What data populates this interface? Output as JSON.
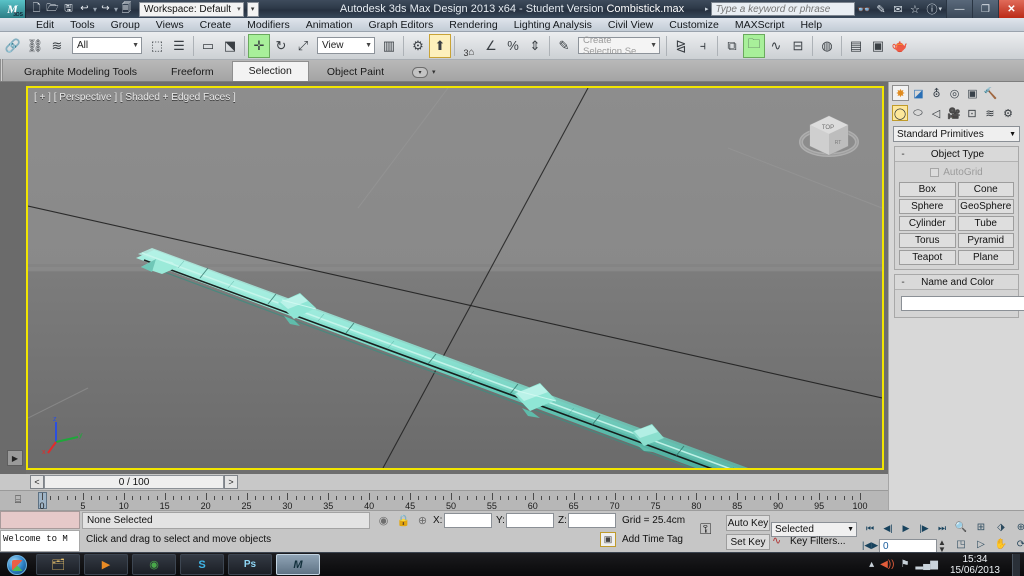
{
  "titlebar": {
    "app_icon": "3dsmax-logo-icon",
    "quick_access": [
      {
        "name": "new-file-button",
        "glyph": "🗋"
      },
      {
        "name": "open-file-button",
        "glyph": "🗁"
      },
      {
        "name": "save-file-button",
        "glyph": "🖫"
      },
      {
        "name": "undo-button",
        "glyph": "↩"
      },
      {
        "name": "redo-button",
        "glyph": "↪"
      },
      {
        "name": "project-folder-button",
        "glyph": "🗐"
      }
    ],
    "workspace_label": "Workspace: Default",
    "title": "Autodesk 3ds Max Design 2013 x64  - Student Version  ",
    "filename": "Combistick.max",
    "search_placeholder": "Type a keyword or phrase",
    "right_icons": [
      {
        "name": "search-binoculars-icon",
        "glyph": "👓"
      },
      {
        "name": "subscription-center-icon",
        "glyph": "✎"
      },
      {
        "name": "communication-center-icon",
        "glyph": "✉"
      },
      {
        "name": "favorites-star-icon",
        "glyph": "☆"
      },
      {
        "name": "help-icon",
        "glyph": "?"
      }
    ],
    "window_buttons": [
      {
        "name": "minimize-button",
        "glyph": "—"
      },
      {
        "name": "restore-button",
        "glyph": "❐"
      },
      {
        "name": "close-button",
        "glyph": "✕"
      }
    ]
  },
  "menubar": {
    "items": [
      "Edit",
      "Tools",
      "Group",
      "Views",
      "Create",
      "Modifiers",
      "Animation",
      "Graph Editors",
      "Rendering",
      "Lighting Analysis",
      "Civil View",
      "Customize",
      "MAXScript",
      "Help"
    ]
  },
  "maintoolbar": {
    "selection_filter": "All",
    "reference_coord": "View",
    "named_selection_placeholder": "Create Selection Se",
    "angle_snap_value": "3",
    "buttons": [
      {
        "name": "select-and-link-icon",
        "glyph": "🔗"
      },
      {
        "name": "unlink-selection-icon",
        "glyph": "⛓"
      },
      {
        "name": "bind-to-space-warp-icon",
        "glyph": "≈"
      },
      {
        "name": "select-object-icon",
        "glyph": "⬚"
      },
      {
        "name": "select-by-name-icon",
        "glyph": "☰"
      },
      {
        "name": "rectangular-selection-region-icon",
        "glyph": "▭"
      },
      {
        "name": "window-crossing-icon",
        "glyph": "⬓"
      },
      {
        "name": "select-and-move-icon",
        "glyph": "✛"
      },
      {
        "name": "select-and-rotate-icon",
        "glyph": "↻"
      },
      {
        "name": "select-and-scale-icon",
        "glyph": "⤢"
      },
      {
        "name": "use-center-flyout-icon",
        "glyph": "⌖"
      },
      {
        "name": "select-and-manipulate-icon",
        "glyph": "⬆"
      },
      {
        "name": "snaps-toggle-icon",
        "glyph": "🧲"
      },
      {
        "name": "angle-snap-toggle-icon",
        "glyph": "∠"
      },
      {
        "name": "percent-snap-toggle-icon",
        "glyph": "%"
      },
      {
        "name": "spinner-snap-toggle-icon",
        "glyph": "⇕"
      },
      {
        "name": "edit-named-selection-icon",
        "glyph": "✎"
      },
      {
        "name": "mirror-icon",
        "glyph": "⧎"
      },
      {
        "name": "align-icon",
        "glyph": "⌷"
      },
      {
        "name": "layer-manager-icon",
        "glyph": "⧉"
      },
      {
        "name": "curve-editor-icon",
        "glyph": "∿"
      },
      {
        "name": "schematic-view-icon",
        "glyph": "⊟"
      },
      {
        "name": "material-editor-icon",
        "glyph": "◎"
      },
      {
        "name": "render-setup-icon",
        "glyph": "⚙"
      },
      {
        "name": "rendered-frame-window-icon",
        "glyph": "▣"
      },
      {
        "name": "render-production-icon",
        "glyph": "🫖"
      }
    ]
  },
  "ribbon": {
    "tabs": [
      "Graphite Modeling Tools",
      "Freeform",
      "Selection",
      "Object Paint"
    ],
    "selected": "Selection"
  },
  "viewport": {
    "label": "[ + ] [ Perspective ] [ Shaded + Edged Faces ]",
    "viewcube_name": "view-cube",
    "axis_tripod_labels": [
      "z",
      "x",
      "y"
    ],
    "model_name": "combistick-mesh",
    "model_color": "#7fded0"
  },
  "timeslider": {
    "prev_glyph": "<",
    "next_glyph": ">",
    "frame_readout": "0 / 100"
  },
  "trackbar": {
    "key_mode_icon": "key-filter-icon",
    "tick_labels": [
      "0",
      "5",
      "10",
      "15",
      "20",
      "25",
      "30",
      "35",
      "40",
      "45",
      "50",
      "55",
      "60",
      "65",
      "70",
      "75",
      "80",
      "85",
      "90",
      "95",
      "100"
    ],
    "range_start": 0,
    "range_end": 100
  },
  "command_panel": {
    "tabs": [
      {
        "name": "create-tab",
        "glyph": "✸",
        "selected": true
      },
      {
        "name": "modify-tab",
        "glyph": "◪",
        "selected": false
      },
      {
        "name": "hierarchy-tab",
        "glyph": "⛢",
        "selected": false
      },
      {
        "name": "motion-tab",
        "glyph": "◎",
        "selected": false
      },
      {
        "name": "display-tab",
        "glyph": "▣",
        "selected": false
      },
      {
        "name": "utilities-tab",
        "glyph": "🔨",
        "selected": false
      }
    ],
    "category_buttons": [
      {
        "name": "geometry-category-button",
        "glyph": "◯",
        "selected": true
      },
      {
        "name": "shapes-category-button",
        "glyph": "⬭",
        "selected": false
      },
      {
        "name": "lights-category-button",
        "glyph": "◁",
        "selected": false
      },
      {
        "name": "cameras-category-button",
        "glyph": "🎥",
        "selected": false
      },
      {
        "name": "helpers-category-button",
        "glyph": "⊡",
        "selected": false
      },
      {
        "name": "space-warps-category-button",
        "glyph": "≈",
        "selected": false
      },
      {
        "name": "systems-category-button",
        "glyph": "⚙",
        "selected": false
      }
    ],
    "primitive_dropdown": "Standard Primitives",
    "object_type_rollout": {
      "title": "Object Type",
      "collapse_glyph": "-",
      "autogrid_label": "AutoGrid",
      "autogrid_checked": false,
      "buttons": [
        "Box",
        "Cone",
        "Sphere",
        "GeoSphere",
        "Cylinder",
        "Tube",
        "Torus",
        "Pyramid",
        "Teapot",
        "Plane"
      ]
    },
    "name_and_color_rollout": {
      "title": "Name and Color",
      "collapse_glyph": "-",
      "name_value": "",
      "color_swatch": "#8d1d33"
    }
  },
  "status": {
    "mini_listener_text": "Welcome to M",
    "selection_status": "None Selected",
    "prompt_text": "Click and drag to select and move objects",
    "icons": [
      {
        "name": "selection-lock-light-icon",
        "glyph": "◉"
      },
      {
        "name": "selection-lock-toggle-icon",
        "glyph": "🔒"
      },
      {
        "name": "absolute-relative-transform-icon",
        "glyph": "⊕"
      }
    ],
    "coord_labels": [
      "X:",
      "Y:",
      "Z:"
    ],
    "coord_values": [
      "",
      "",
      ""
    ],
    "grid_label": "Grid = 25.4cm",
    "add_time_tag": "Add Time Tag",
    "key_mode_icon": "key-toggle-icon",
    "auto_key_label": "Auto Key",
    "set_key_label": "Set Key",
    "key_filters_label": "Key Filters...",
    "selection_set": "Selected",
    "current_frame": "0",
    "playback_buttons": [
      {
        "name": "go-to-start-button",
        "glyph": "|◀◀"
      },
      {
        "name": "previous-frame-button",
        "glyph": "◀||"
      },
      {
        "name": "play-animation-button",
        "glyph": "▶"
      },
      {
        "name": "next-frame-button",
        "glyph": "||▶"
      },
      {
        "name": "go-to-end-button",
        "glyph": "▶▶|"
      }
    ],
    "key_nav_button": {
      "name": "key-mode-toggle-button",
      "glyph": "|◀▶|"
    },
    "nav_buttons": [
      {
        "name": "zoom-icon",
        "glyph": "🔍"
      },
      {
        "name": "zoom-all-icon",
        "glyph": "⊞"
      },
      {
        "name": "zoom-extents-icon",
        "glyph": "⬗"
      },
      {
        "name": "zoom-extents-all-icon",
        "glyph": "⊕"
      },
      {
        "name": "field-of-view-icon",
        "glyph": "◳"
      },
      {
        "name": "walk-through-icon",
        "glyph": "▷"
      },
      {
        "name": "pan-view-icon",
        "glyph": "✋"
      },
      {
        "name": "orbit-icon",
        "glyph": "⟳"
      },
      {
        "name": "maximize-viewport-icon",
        "glyph": "⤢"
      }
    ]
  },
  "taskbar": {
    "start_button": "start-orb",
    "items": [
      {
        "name": "taskbar-item-explorer",
        "glyph": "🗂",
        "active": false
      },
      {
        "name": "taskbar-item-media-player",
        "glyph": "▶",
        "active": false
      },
      {
        "name": "taskbar-item-chrome",
        "glyph": "◉",
        "active": false
      },
      {
        "name": "taskbar-item-skype",
        "glyph": "S",
        "active": false
      },
      {
        "name": "taskbar-item-photoshop",
        "glyph": "Ps",
        "active": false
      },
      {
        "name": "taskbar-item-3dsmax",
        "glyph": "M",
        "active": true
      }
    ],
    "tray_icons": [
      {
        "name": "tray-expand-icon",
        "glyph": "▲"
      },
      {
        "name": "volume-icon",
        "glyph": "🔊"
      },
      {
        "name": "action-center-icon",
        "glyph": "⚐"
      },
      {
        "name": "network-icon",
        "glyph": "▂▄▆"
      }
    ],
    "clock_time": "15:34",
    "clock_date": "15/06/2013"
  }
}
